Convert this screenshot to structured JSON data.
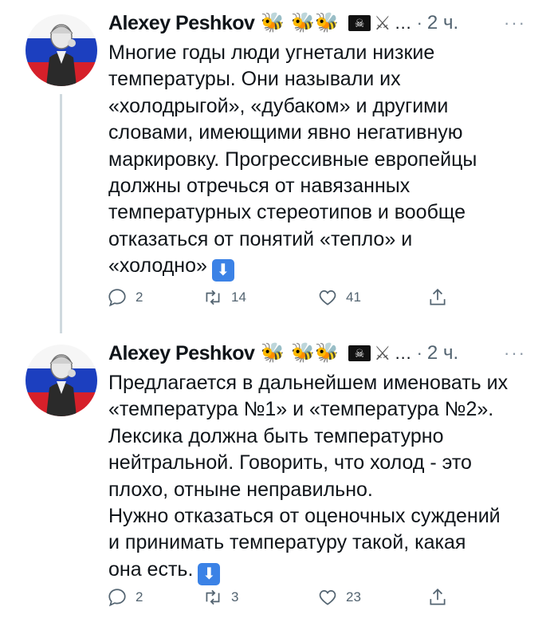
{
  "author": {
    "name": "Alexey Peshkov",
    "badges": [
      "🐝",
      "🐝",
      "🐝"
    ],
    "flag_icon": "pirate-flag-icon",
    "swords_icon": "crossed-swords-icon",
    "ellipsis": "…",
    "separator": "·"
  },
  "tweets": [
    {
      "time": "2 ч.",
      "text": "Многие годы люди угнетали низкие\nтемпературы. Они называли их\n«холодрыгой», «дубаком» и другими\nсловами, имеющими явно негативную\nмаркировку. Прогрессивные европейцы\nдолжны отречься от навязанных\nтемпературных стереотипов и вообще\nотказаться от понятий «тепло» и\n«холодно»",
      "replies": "2",
      "retweets": "14",
      "likes": "41"
    },
    {
      "time": "2 ч.",
      "text": "Предлагается в дальнейшем именовать их\n«температура №1» и «температура №2».\nЛексика должна быть температурно\nнейтральной. Говорить, что холод - это\nплохо, отныне неправильно.\nНужно отказаться от оценочных суждений\nи принимать температуру такой, какая\nона есть.",
      "replies": "2",
      "retweets": "3",
      "likes": "23"
    }
  ],
  "icons": {
    "more": "···",
    "down_arrow": "⬇"
  },
  "colors": {
    "text": "#0f1419",
    "muted": "#536471",
    "thread_line": "#cfd9de",
    "emoji_blue": "#3b82e6",
    "flag_white": "#f6f6f6",
    "flag_blue": "#1c3fbf",
    "flag_red": "#d6202a"
  }
}
